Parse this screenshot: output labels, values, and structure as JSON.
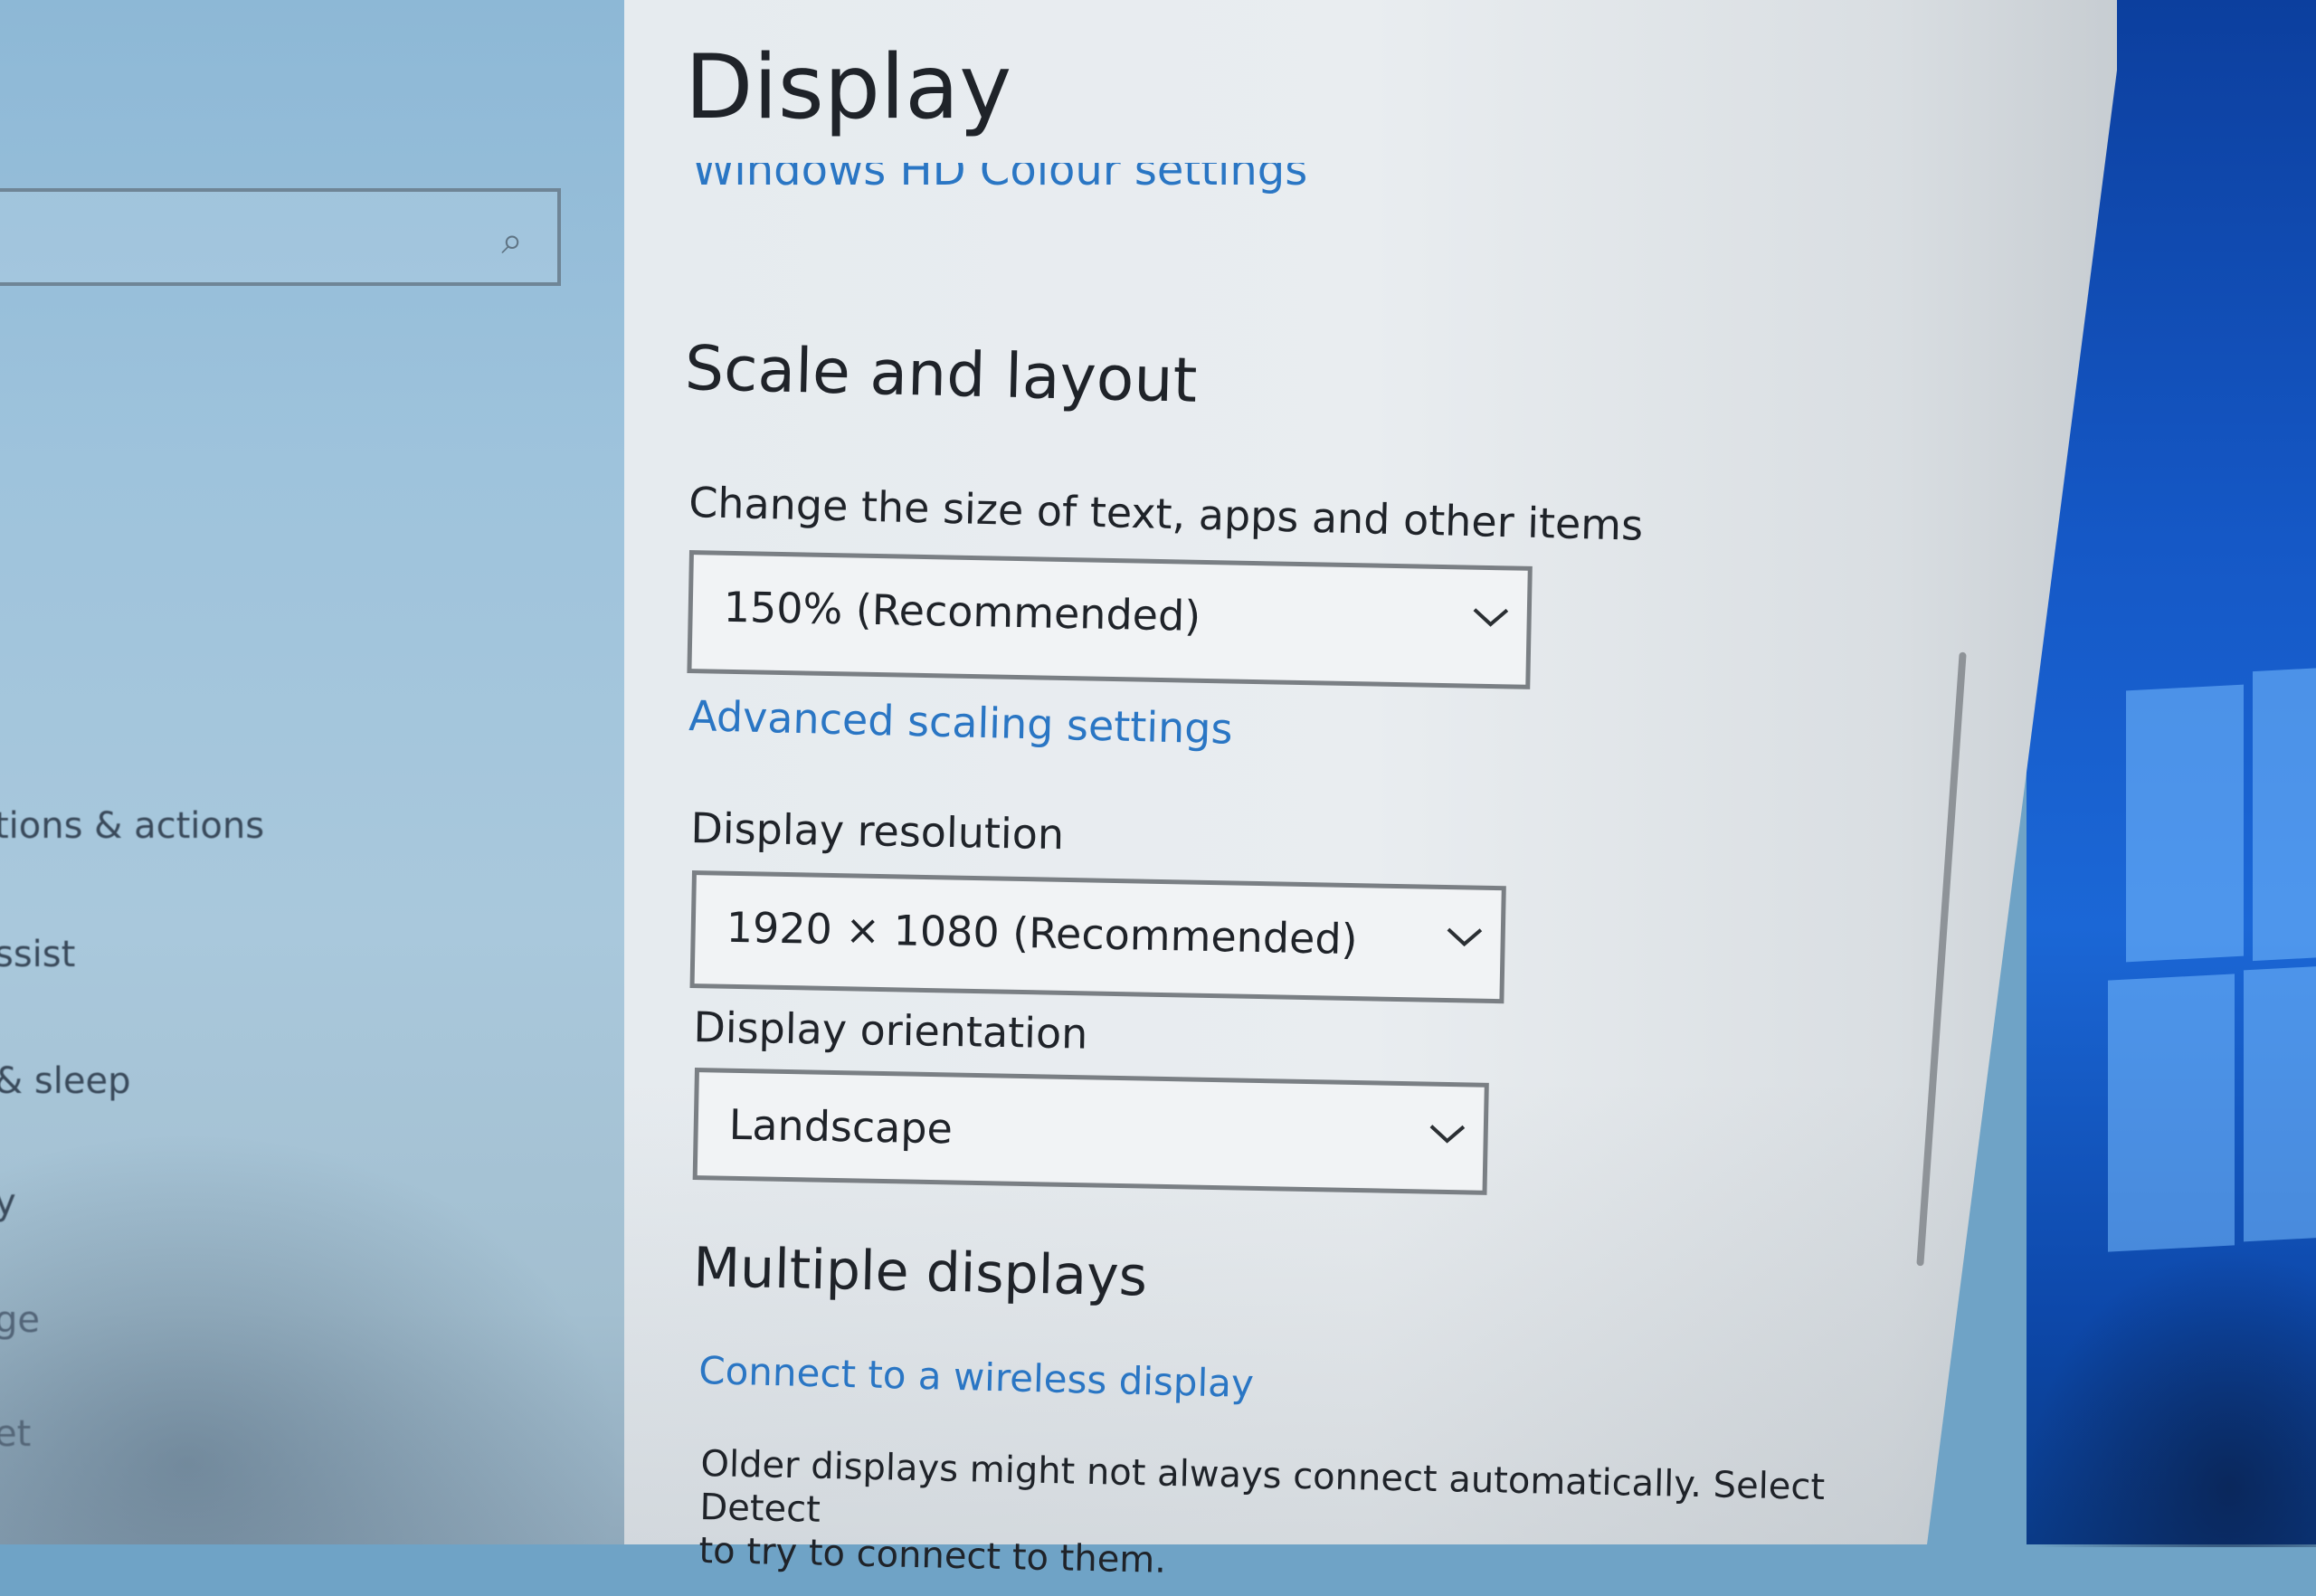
{
  "page": {
    "title": "Display",
    "header_link": "Windows HD Colour settings"
  },
  "sidebar": {
    "search_icon": "search-icon",
    "items": [
      {
        "label": "tions & actions"
      },
      {
        "label": "ssist"
      },
      {
        "label": "& sleep"
      },
      {
        "label": "y"
      },
      {
        "label": "ge"
      },
      {
        "label": "et"
      }
    ]
  },
  "scale_layout": {
    "heading": "Scale and layout",
    "size_label": "Change the size of text, apps and other items",
    "size_value": "150% (Recommended)",
    "advanced_link": "Advanced scaling settings",
    "resolution_label": "Display resolution",
    "resolution_value": "1920 × 1080 (Recommended)",
    "orientation_label": "Display orientation",
    "orientation_value": "Landscape"
  },
  "multiple_displays": {
    "heading": "Multiple displays",
    "wireless_link": "Connect to a wireless display",
    "note_line1": "Older displays might not always connect automatically. Select Detect",
    "note_line2": "to try to connect to them."
  },
  "colors": {
    "accent": "#2a76c4",
    "panel_bg": "#e9edf0",
    "sidebar_bg": "#9ec3dc",
    "desktop_bg": "#1558c6"
  }
}
